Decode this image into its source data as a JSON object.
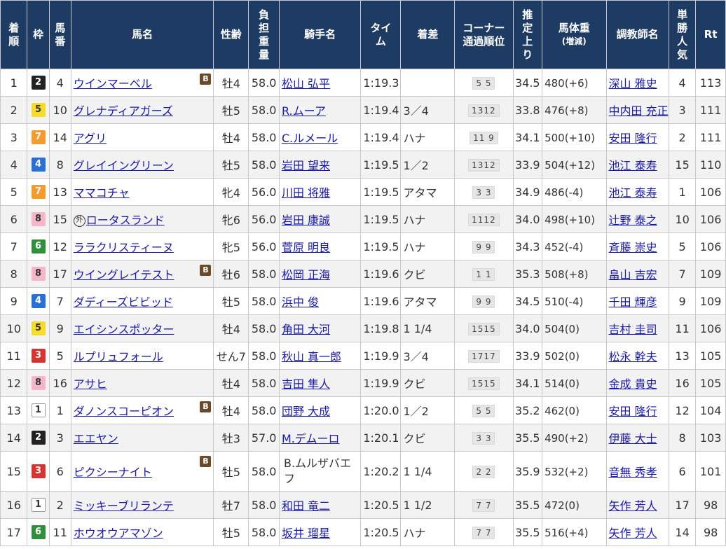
{
  "headers": {
    "rank": "着順",
    "waku": "枠",
    "umaban": "馬番",
    "horse": "馬名",
    "sexage": "性齢",
    "weight": "負担重量",
    "jockey": "騎手名",
    "time": "タイム",
    "margin": "着差",
    "corner": "コーナー通過順位",
    "last3f": "推定上り",
    "bodyweight": "馬体重",
    "bodyweight_sub": "(増減)",
    "trainer": "調教師名",
    "pop": "単勝人気",
    "rt": "Rt"
  },
  "blinker_label": "B",
  "foreign_mark": "外",
  "colors": {
    "header_bg": "#1e3c63",
    "link": "#1a1aa6",
    "blinker_bg": "#6b4a2a"
  },
  "rows": [
    {
      "rank": "1",
      "waku": "2",
      "umaban": "4",
      "horse": "ウインマーベル",
      "blinker": true,
      "foreign": false,
      "sexage": "牡4",
      "weight": "58.0",
      "jockey": "松山 弘平",
      "time": "1:19.3",
      "margin": "",
      "corner": "5 5",
      "last3f": "34.5",
      "bw": "480",
      "bwdiff": "(+6)",
      "trainer": "深山 雅史",
      "pop": "4",
      "rt": "113"
    },
    {
      "rank": "2",
      "waku": "5",
      "umaban": "10",
      "horse": "グレナディアガーズ",
      "blinker": false,
      "foreign": false,
      "sexage": "牡5",
      "weight": "58.0",
      "jockey": "R.ムーア",
      "time": "1:19.4",
      "margin": "3／4",
      "corner": "1312",
      "last3f": "33.8",
      "bw": "476",
      "bwdiff": "(+8)",
      "trainer": "中内田 充正",
      "pop": "3",
      "rt": "111"
    },
    {
      "rank": "3",
      "waku": "7",
      "umaban": "14",
      "horse": "アグリ",
      "blinker": false,
      "foreign": false,
      "sexage": "牡4",
      "weight": "58.0",
      "jockey": "C.ルメール",
      "time": "1:19.4",
      "margin": "ハナ",
      "corner": "11 9",
      "last3f": "34.1",
      "bw": "500",
      "bwdiff": "(+10)",
      "trainer": "安田 隆行",
      "pop": "2",
      "rt": "111"
    },
    {
      "rank": "4",
      "waku": "4",
      "umaban": "8",
      "horse": "グレイイングリーン",
      "blinker": false,
      "foreign": false,
      "sexage": "牡5",
      "weight": "58.0",
      "jockey": "岩田 望来",
      "time": "1:19.5",
      "margin": "1／2",
      "corner": "1312",
      "last3f": "33.9",
      "bw": "504",
      "bwdiff": "(+12)",
      "trainer": "池江 泰寿",
      "pop": "15",
      "rt": "110"
    },
    {
      "rank": "5",
      "waku": "7",
      "umaban": "13",
      "horse": "ママコチャ",
      "blinker": false,
      "foreign": false,
      "sexage": "牝4",
      "weight": "56.0",
      "jockey": "川田 将雅",
      "time": "1:19.5",
      "margin": "アタマ",
      "corner": "3 3",
      "last3f": "34.9",
      "bw": "486",
      "bwdiff": "(-4)",
      "trainer": "池江 泰寿",
      "pop": "1",
      "rt": "106"
    },
    {
      "rank": "6",
      "waku": "8",
      "umaban": "15",
      "horse": "ロータスランド",
      "blinker": false,
      "foreign": true,
      "sexage": "牝6",
      "weight": "56.0",
      "jockey": "岩田 康誠",
      "time": "1:19.5",
      "margin": "ハナ",
      "corner": "1112",
      "last3f": "34.0",
      "bw": "498",
      "bwdiff": "(+10)",
      "trainer": "辻野 泰之",
      "pop": "10",
      "rt": "106"
    },
    {
      "rank": "7",
      "waku": "6",
      "umaban": "12",
      "horse": "ララクリスティーヌ",
      "blinker": false,
      "foreign": false,
      "sexage": "牝5",
      "weight": "56.0",
      "jockey": "菅原 明良",
      "time": "1:19.5",
      "margin": "ハナ",
      "corner": "9 9",
      "last3f": "34.3",
      "bw": "452",
      "bwdiff": "(-4)",
      "trainer": "斉藤 崇史",
      "pop": "5",
      "rt": "106"
    },
    {
      "rank": "8",
      "waku": "8",
      "umaban": "17",
      "horse": "ウイングレイテスト",
      "blinker": true,
      "foreign": false,
      "sexage": "牡6",
      "weight": "58.0",
      "jockey": "松岡 正海",
      "time": "1:19.6",
      "margin": "クビ",
      "corner": "1 1",
      "last3f": "35.3",
      "bw": "508",
      "bwdiff": "(+8)",
      "trainer": "畠山 吉宏",
      "pop": "7",
      "rt": "109"
    },
    {
      "rank": "9",
      "waku": "4",
      "umaban": "7",
      "horse": "ダディーズビビッド",
      "blinker": false,
      "foreign": false,
      "sexage": "牡5",
      "weight": "58.0",
      "jockey": "浜中 俊",
      "time": "1:19.6",
      "margin": "アタマ",
      "corner": "9 9",
      "last3f": "34.5",
      "bw": "510",
      "bwdiff": "(-4)",
      "trainer": "千田 輝彦",
      "pop": "9",
      "rt": "109"
    },
    {
      "rank": "10",
      "waku": "5",
      "umaban": "9",
      "horse": "エイシンスポッター",
      "blinker": false,
      "foreign": false,
      "sexage": "牡4",
      "weight": "58.0",
      "jockey": "角田 大河",
      "time": "1:19.8",
      "margin": "1 1/4",
      "corner": "1515",
      "last3f": "34.0",
      "bw": "504",
      "bwdiff": "(0)",
      "trainer": "吉村 圭司",
      "pop": "11",
      "rt": "106"
    },
    {
      "rank": "11",
      "waku": "3",
      "umaban": "5",
      "horse": "ルプリュフォール",
      "blinker": false,
      "foreign": false,
      "sexage": "せん7",
      "weight": "58.0",
      "jockey": "秋山 真一郎",
      "time": "1:19.9",
      "margin": "3／4",
      "corner": "1717",
      "last3f": "33.9",
      "bw": "502",
      "bwdiff": "(0)",
      "trainer": "松永 幹夫",
      "pop": "13",
      "rt": "105"
    },
    {
      "rank": "12",
      "waku": "8",
      "umaban": "16",
      "horse": "アサヒ",
      "blinker": false,
      "foreign": false,
      "sexage": "牡4",
      "weight": "58.0",
      "jockey": "吉田 隼人",
      "time": "1:19.9",
      "margin": "クビ",
      "corner": "1515",
      "last3f": "34.1",
      "bw": "514",
      "bwdiff": "(0)",
      "trainer": "金成 貴史",
      "pop": "16",
      "rt": "105"
    },
    {
      "rank": "13",
      "waku": "1",
      "umaban": "1",
      "horse": "ダノンスコーピオン",
      "blinker": true,
      "foreign": false,
      "sexage": "牡4",
      "weight": "58.0",
      "jockey": "団野 大成",
      "time": "1:20.0",
      "margin": "1／2",
      "corner": "5 5",
      "last3f": "35.2",
      "bw": "462",
      "bwdiff": "(0)",
      "trainer": "安田 隆行",
      "pop": "12",
      "rt": "104"
    },
    {
      "rank": "14",
      "waku": "2",
      "umaban": "3",
      "horse": "エエヤン",
      "blinker": false,
      "foreign": false,
      "sexage": "牡3",
      "weight": "57.0",
      "jockey": "M.デムーロ",
      "time": "1:20.1",
      "margin": "クビ",
      "corner": "3 3",
      "last3f": "35.5",
      "bw": "490",
      "bwdiff": "(+2)",
      "trainer": "伊藤 大士",
      "pop": "8",
      "rt": "103"
    },
    {
      "rank": "15",
      "waku": "3",
      "umaban": "6",
      "horse": "ピクシーナイト",
      "blinker": true,
      "foreign": false,
      "sexage": "牡5",
      "weight": "58.0",
      "jockey": "B.ムルザバエフ",
      "time": "1:20.2",
      "margin": "1 1/4",
      "corner": "2 2",
      "last3f": "35.9",
      "bw": "532",
      "bwdiff": "(+2)",
      "trainer": "音無 秀孝",
      "pop": "6",
      "rt": "101"
    },
    {
      "rank": "16",
      "waku": "1",
      "umaban": "2",
      "horse": "ミッキーブリランテ",
      "blinker": false,
      "foreign": false,
      "sexage": "牡7",
      "weight": "58.0",
      "jockey": "和田 竜二",
      "time": "1:20.5",
      "margin": "1 1/2",
      "corner": "7 7",
      "last3f": "35.5",
      "bw": "472",
      "bwdiff": "(0)",
      "trainer": "矢作 芳人",
      "pop": "17",
      "rt": "98"
    },
    {
      "rank": "17",
      "waku": "6",
      "umaban": "11",
      "horse": "ホウオウアマゾン",
      "blinker": false,
      "foreign": false,
      "sexage": "牡5",
      "weight": "58.0",
      "jockey": "坂井 瑠星",
      "time": "1:20.5",
      "margin": "ハナ",
      "corner": "7 7",
      "last3f": "35.5",
      "bw": "516",
      "bwdiff": "(+4)",
      "trainer": "矢作 芳人",
      "pop": "14",
      "rt": "98"
    }
  ]
}
